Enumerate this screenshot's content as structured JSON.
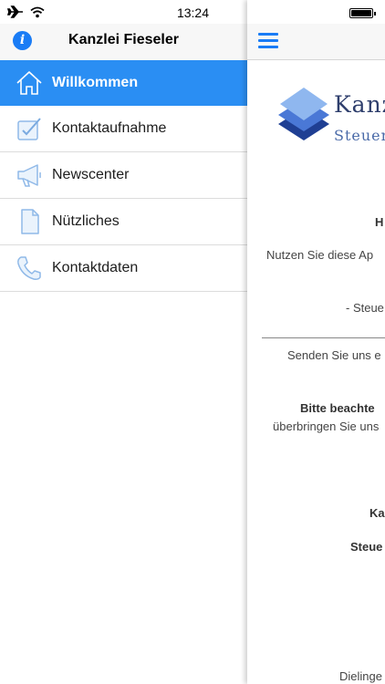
{
  "status_bar": {
    "time": "13:24",
    "icons": [
      "airplane-icon",
      "wifi-icon",
      "battery-icon"
    ]
  },
  "menu": {
    "title": "Kanzlei Fieseler",
    "info_icon_glyph": "i",
    "accent_color": "#2a8ef3",
    "items": [
      {
        "label": "Willkommen",
        "icon": "home-icon",
        "active": true
      },
      {
        "label": "Kontaktaufnahme",
        "icon": "edit-icon",
        "active": false
      },
      {
        "label": "Newscenter",
        "icon": "megaphone-icon",
        "active": false
      },
      {
        "label": "Nützliches",
        "icon": "document-icon",
        "active": false
      },
      {
        "label": "Kontaktdaten",
        "icon": "phone-icon",
        "active": false
      }
    ]
  },
  "content": {
    "logo_title": "Kanzl",
    "logo_subtitle": "Steuer",
    "lines": [
      "H",
      "Nutzen Sie diese Ap",
      "- Steue",
      "Senden Sie uns e",
      "Bitte beachte",
      "überbringen Sie uns",
      "Ka",
      "Steue",
      "Dielinge"
    ]
  }
}
